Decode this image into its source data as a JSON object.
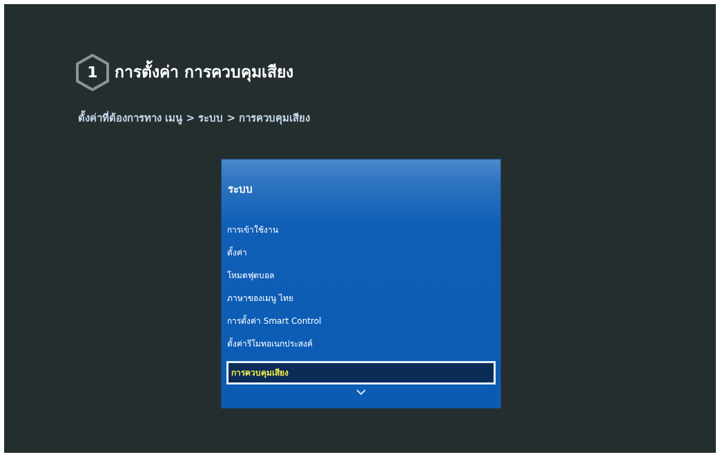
{
  "screen": {
    "step": "1",
    "title": "การตั้งค่า การควบคุมเสียง",
    "instruction": "ตั้งค่าที่ต้องการทาง เมนู > ระบบ > การควบคุมเสียง"
  },
  "menu": {
    "title": "ระบบ",
    "items": [
      {
        "label": "การเข้าใช้งาน",
        "selected": false
      },
      {
        "label": "ตั้งค่า",
        "selected": false
      },
      {
        "label": "โหมดฟุตบอล",
        "selected": false
      },
      {
        "label": "ภาษาของเมนู ไทย",
        "selected": false
      },
      {
        "label": "การตั้งค่า Smart Control",
        "selected": false
      },
      {
        "label": "ตั้งค่ารีโมทอเนกประสงค์",
        "selected": false
      },
      {
        "label": "การควบคุมเสียง",
        "selected": true
      }
    ],
    "more_below": true
  }
}
